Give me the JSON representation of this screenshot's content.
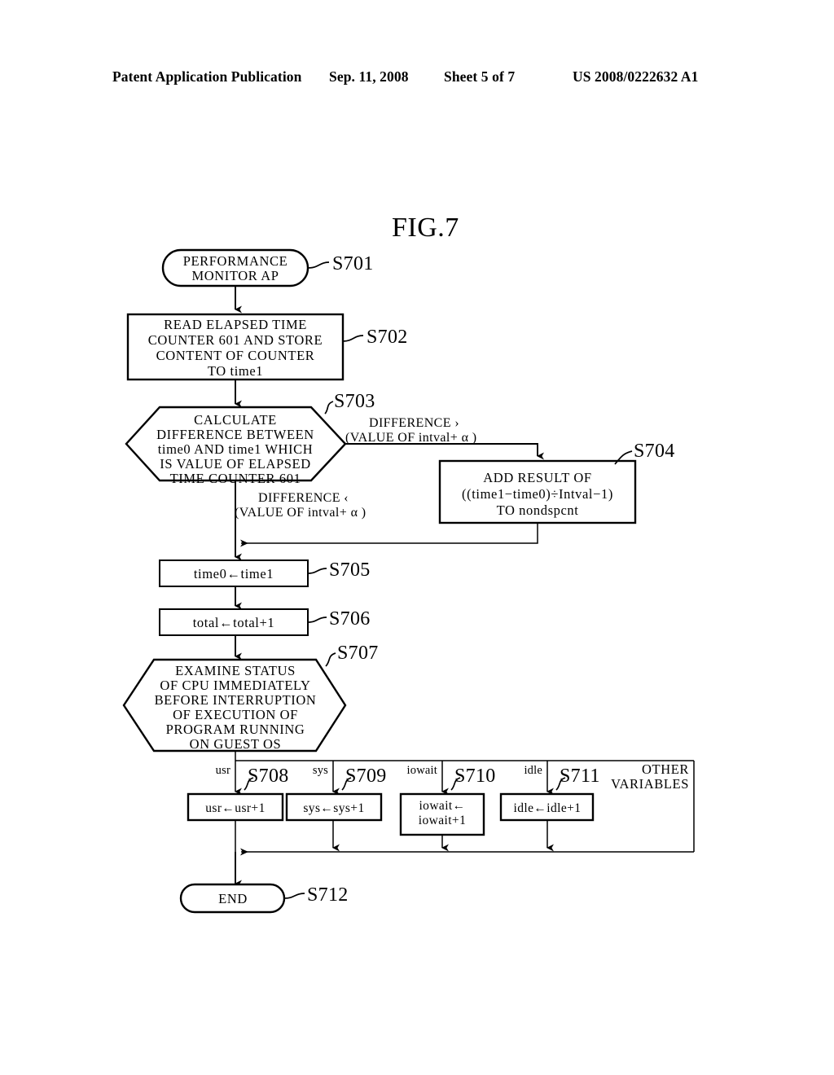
{
  "header": {
    "publication": "Patent Application Publication",
    "date": "Sep. 11, 2008",
    "sheet": "Sheet 5 of 7",
    "docnum": "US 2008/0222632 A1"
  },
  "figure": {
    "title": "FIG.7"
  },
  "nodes": {
    "s701": {
      "label": "S701",
      "shape": "terminator",
      "lines": [
        "PERFORMANCE",
        "MONITOR  AP"
      ]
    },
    "s702": {
      "label": "S702",
      "shape": "process",
      "lines": [
        "READ  ELAPSED  TIME",
        "COUNTER  601  AND  STORE",
        "CONTENT  OF  COUNTER",
        "TO  time1"
      ]
    },
    "s703": {
      "label": "S703",
      "shape": "decision-hexagon",
      "lines": [
        "CALCULATE",
        "DIFFERENCE  BETWEEN",
        "time0  AND  time1  WHICH",
        "IS  VALUE  OF  ELAPSED",
        "TIME  COUNTER  601"
      ]
    },
    "s704": {
      "label": "S704",
      "shape": "process",
      "lines": [
        "ADD  RESULT  OF",
        "((time1−time0)÷Intval−1)",
        "TO  nondspcnt"
      ]
    },
    "s705": {
      "label": "S705",
      "shape": "process",
      "lines": [
        "time0←time1"
      ]
    },
    "s706": {
      "label": "S706",
      "shape": "process",
      "lines": [
        "total←total+1"
      ]
    },
    "s707": {
      "label": "S707",
      "shape": "decision-hexagon",
      "lines": [
        "EXAMINE  STATUS",
        "OF  CPU  IMMEDIATELY",
        "BEFORE  INTERRUPTION",
        "OF  EXECUTION  OF",
        "PROGRAM  RUNNING",
        "ON  GUEST  OS"
      ]
    },
    "s708": {
      "label": "S708",
      "shape": "process",
      "lines": [
        "usr←usr+1"
      ]
    },
    "s709": {
      "label": "S709",
      "shape": "process",
      "lines": [
        "sys←sys+1"
      ]
    },
    "s710": {
      "label": "S710",
      "shape": "process",
      "lines": [
        "iowait←",
        "iowait+1"
      ]
    },
    "s711": {
      "label": "S711",
      "shape": "process",
      "lines": [
        "idle←idle+1"
      ]
    },
    "s712": {
      "label": "S712",
      "shape": "terminator",
      "lines": [
        "END"
      ]
    }
  },
  "branch_labels": {
    "greater": {
      "line1": "DIFFERENCE ›",
      "line2": "(VALUE OF  intval+ α )"
    },
    "less": {
      "line1": "DIFFERENCE ‹",
      "line2": "(VALUE OF  intval+ α )"
    },
    "usr": "usr",
    "sys": "sys",
    "iowait": "iowait",
    "idle": "idle",
    "other": {
      "line1": "OTHER",
      "line2": "VARIABLES"
    }
  },
  "colors": {
    "ink": "#000000",
    "paper": "#ffffff"
  }
}
